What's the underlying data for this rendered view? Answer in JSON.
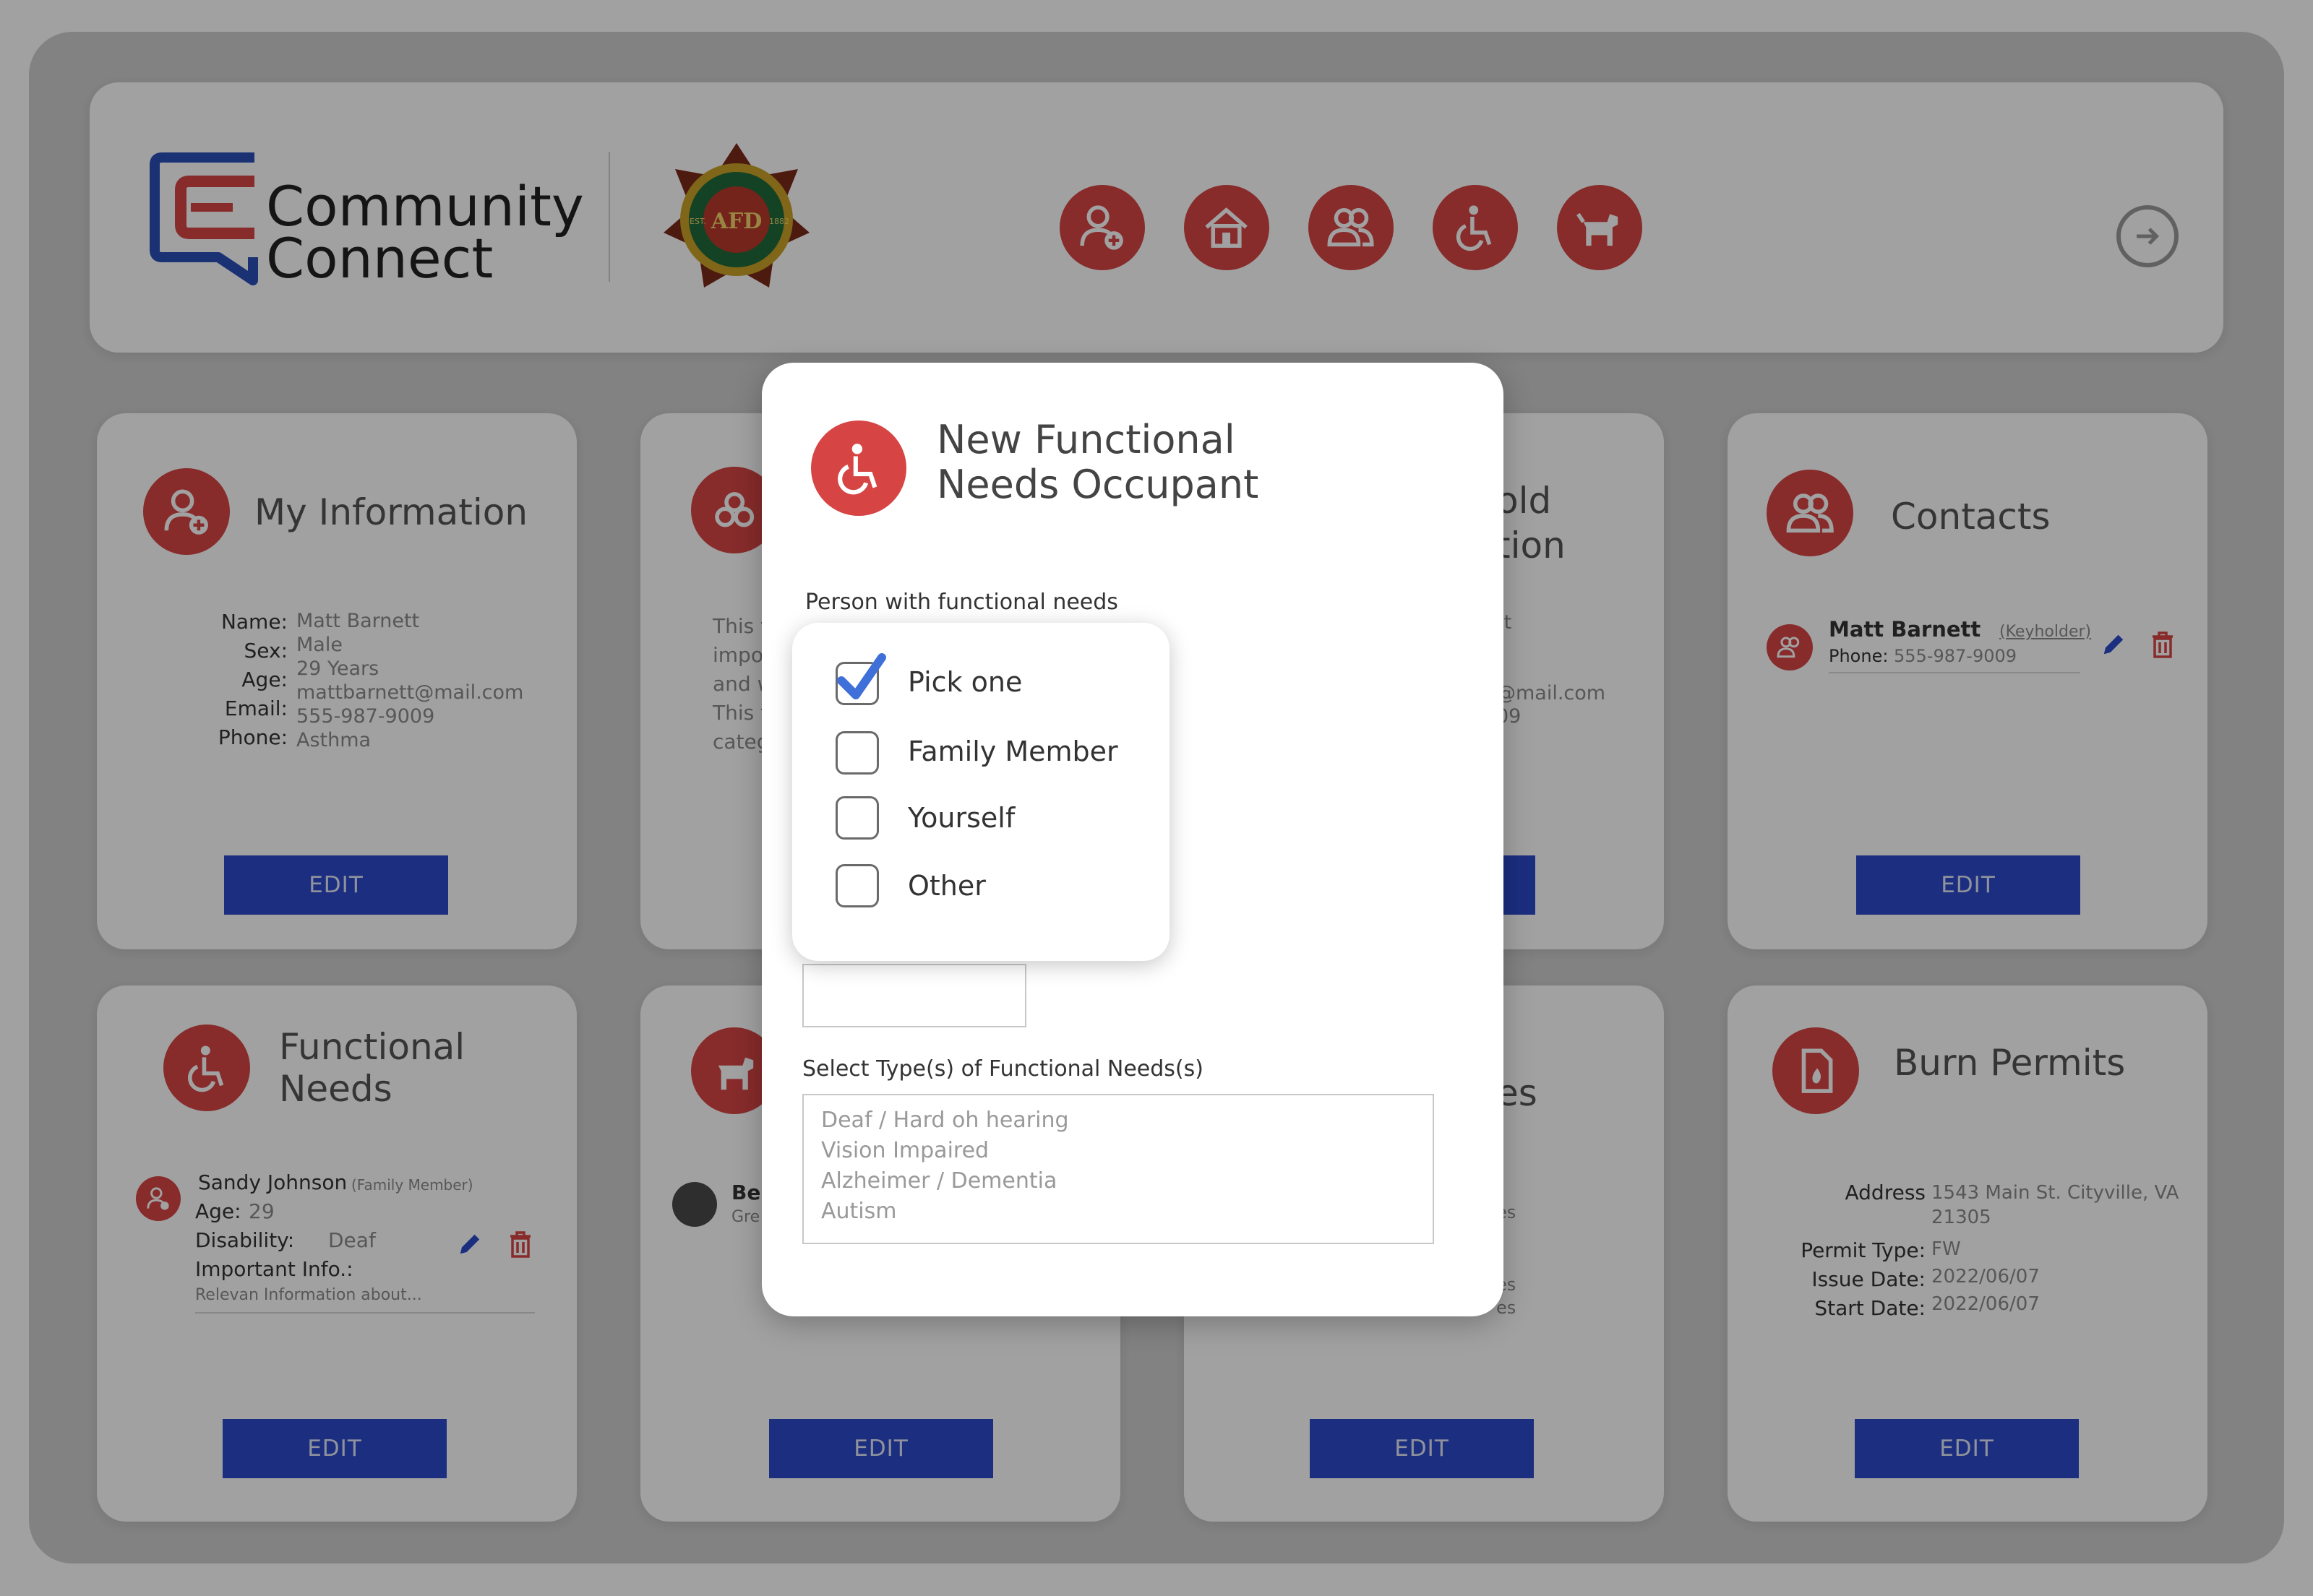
{
  "app": {
    "logo_line1": "Community",
    "logo_line2": "Connect",
    "seal": {
      "text_top": "CITY OF ASHEVILLE",
      "text_bottom": "FIRE DEPARTMENT",
      "est": "EST.",
      "year": "1882",
      "letters": "AFD"
    }
  },
  "nav_icons": [
    "add-person-icon",
    "house-icon",
    "people-icon",
    "wheelchair-icon",
    "dog-icon",
    "logout-icon"
  ],
  "colors": {
    "accent_red": "#d64444",
    "button_blue": "#2b4ac9",
    "check_blue": "#3f6fd8"
  },
  "cards": {
    "my_info": {
      "title": "My Information",
      "fields": [
        {
          "label": "Name:",
          "value": "Matt Barnett"
        },
        {
          "label": "Sex:",
          "value": "Male"
        },
        {
          "label": "Age:",
          "value": "29 Years"
        },
        {
          "label": "Email:",
          "value": "mattbarnett@mail.com"
        },
        {
          "label": "Phone:",
          "value": "555-987-9009"
        },
        {
          "label": "",
          "value": "Asthma"
        }
      ],
      "edit": "EDIT"
    },
    "hazards": {
      "text": [
        "This tex",
        "importa",
        "and wha",
        "This tex",
        "category"
      ]
    },
    "household": {
      "title_line1": "old",
      "title_line2": "tion",
      "fragments": [
        "tt",
        "@mail.com",
        "09"
      ],
      "edit": ""
    },
    "contacts": {
      "title": "Contacts",
      "name": "Matt Barnett",
      "tag": "(Keyholder)",
      "phone_label": "Phone:",
      "phone": "555-987-9009",
      "edit": "EDIT"
    },
    "functional_needs": {
      "title_line1": "Functional",
      "title_line2": "Needs",
      "name": "Sandy Johnson",
      "tag": "(Family Member)",
      "age_label": "Age:",
      "age": "29",
      "disability_label": "Disability:",
      "disability": "Deaf",
      "important_label": "Important Info.:",
      "important": "Relevan Information about...",
      "edit": "EDIT"
    },
    "pets": {
      "name_fragment": "Be",
      "sub_fragment": "Gre",
      "edit": "EDIT"
    },
    "vehicles": {
      "title_fragment": "es",
      "fragments": [
        "es",
        "es",
        "es"
      ],
      "edit": "EDIT"
    },
    "burn_permits": {
      "title": "Burn Permits",
      "address_label": "Address",
      "address_line1": "1543 Main St. Cityville, VA",
      "address_line2": "21305",
      "permit_type_label": "Permit Type:",
      "permit_type": "FW",
      "issue_label": "Issue Date:",
      "issue": "2022/06/07",
      "start_label": "Start Date:",
      "start": "2022/06/07",
      "edit": "EDIT"
    }
  },
  "modal": {
    "title_line1": "New Functional",
    "title_line2": "Needs Occupant",
    "person_label": "Person with functional needs",
    "options": [
      {
        "label": "Pick one",
        "checked": true
      },
      {
        "label": "Family Member",
        "checked": false
      },
      {
        "label": "Yourself",
        "checked": false
      },
      {
        "label": "Other",
        "checked": false
      }
    ],
    "text_value": "",
    "types_label": "Select Type(s) of Functional Needs(s)",
    "types": [
      "Deaf / Hard oh hearing",
      "Vision Impaired",
      "Alzheimer / Dementia",
      "Autism"
    ]
  }
}
